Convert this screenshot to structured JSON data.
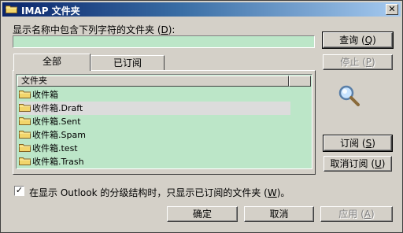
{
  "window": {
    "title": "IMAP 文件夹",
    "close_glyph": "✕"
  },
  "search": {
    "label_prefix": "显示名称中包含下列字符的文件夹 (",
    "label_key": "D",
    "label_suffix": "):",
    "value": ""
  },
  "buttons": {
    "query": {
      "prefix": "查询 (",
      "key": "Q",
      "suffix": ")"
    },
    "stop": {
      "prefix": "停止 (",
      "key": "P",
      "suffix": ")"
    },
    "subscribe": {
      "prefix": "订阅 (",
      "key": "S",
      "suffix": ")"
    },
    "unsubscribe": {
      "prefix": "取消订阅 (",
      "key": "U",
      "suffix": ")"
    },
    "ok": "确定",
    "cancel": "取消",
    "apply": {
      "prefix": "应用 (",
      "key": "A",
      "suffix": ")"
    }
  },
  "tabs": [
    {
      "label": "全部",
      "active": true
    },
    {
      "label": "已订阅",
      "active": false
    }
  ],
  "list": {
    "column_header": "文件夹",
    "items": [
      {
        "label": "收件箱",
        "selected": false
      },
      {
        "label": "收件箱.Draft",
        "selected": true
      },
      {
        "label": "收件箱.Sent",
        "selected": false
      },
      {
        "label": "收件箱.Spam",
        "selected": false
      },
      {
        "label": "收件箱.test",
        "selected": false
      },
      {
        "label": "收件箱.Trash",
        "selected": false
      }
    ]
  },
  "option": {
    "checked": true,
    "check_glyph": "✓",
    "label_prefix": "在显示 Outlook 的分级结构时，只显示已订阅的文件夹 (",
    "label_key": "W",
    "label_suffix": ")。"
  },
  "icons": {
    "title": "folder-icon",
    "search_animation": "magnifier-icon",
    "list_item": "folder-icon"
  },
  "colors": {
    "list_background": "#bce6c8",
    "titlebar_start": "#0a246a",
    "titlebar_end": "#a6caf0"
  }
}
